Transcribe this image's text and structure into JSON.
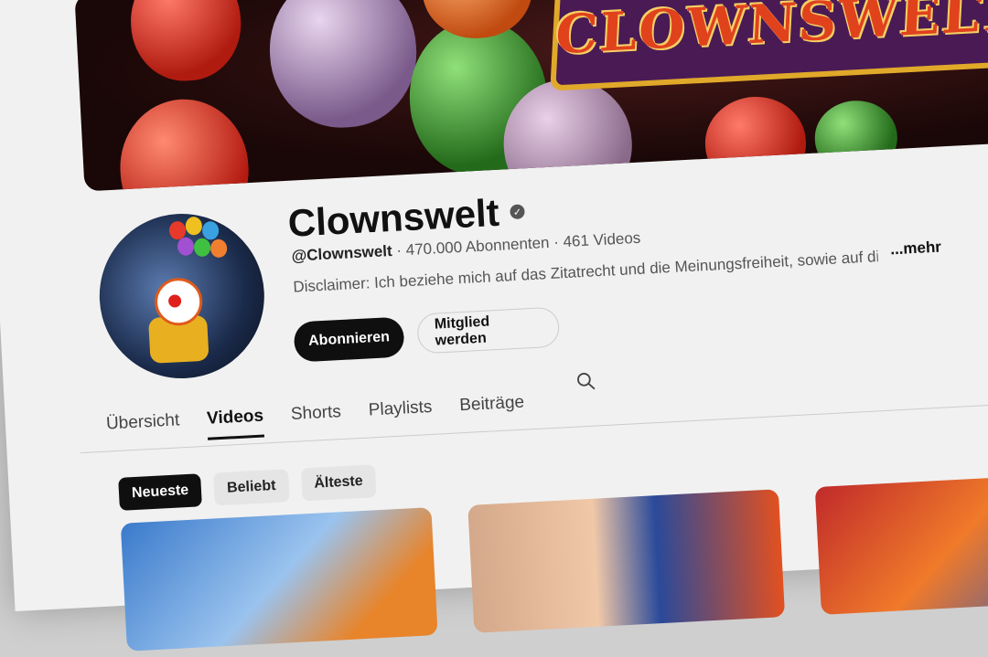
{
  "banner": {
    "sign_text": "CLOWNSWELT"
  },
  "channel": {
    "name": "Clownswelt",
    "handle": "@Clownswelt",
    "subscribers": "470.000 Abonnenten",
    "videos": "461 Videos",
    "description": "Disclaimer: Ich beziehe mich auf das Zitatrecht und die Meinungsfreiheit, sowie auf die",
    "more_label": "...mehr"
  },
  "buttons": {
    "subscribe": "Abonnieren",
    "member": "Mitglied werden"
  },
  "tabs": [
    {
      "label": "Übersicht"
    },
    {
      "label": "Videos"
    },
    {
      "label": "Shorts"
    },
    {
      "label": "Playlists"
    },
    {
      "label": "Beiträge"
    }
  ],
  "chips": [
    {
      "label": "Neueste"
    },
    {
      "label": "Beliebt"
    },
    {
      "label": "Älteste"
    }
  ],
  "colors": {
    "accent": "#0f0f0f",
    "background": "#f1f1f1"
  },
  "icons": {
    "verified": "verified-check-icon",
    "search": "search-icon"
  }
}
